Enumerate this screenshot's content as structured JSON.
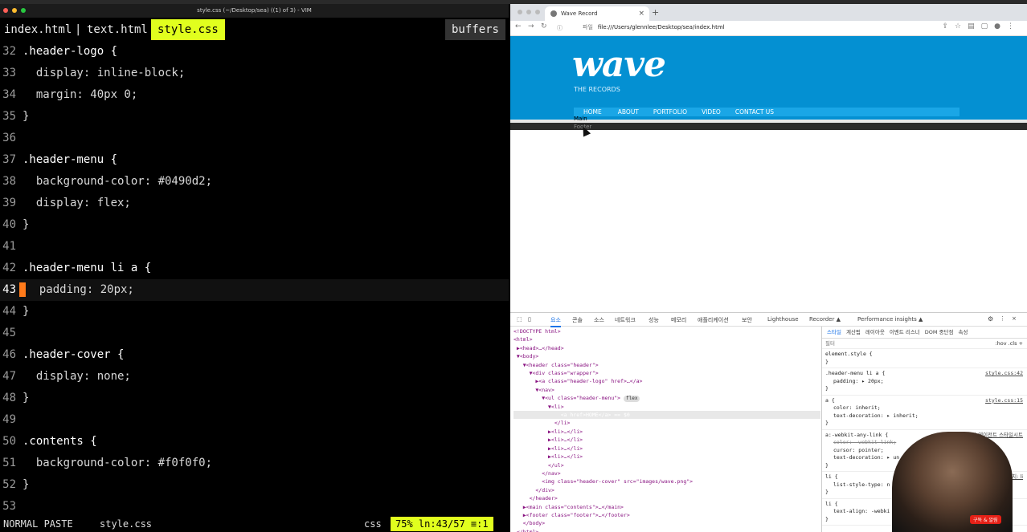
{
  "vim": {
    "title": "style.css (~/Desktop/sea) ((1) of 3) - VIM",
    "tabs": [
      "index.html",
      "text.html",
      "style.css"
    ],
    "tab_sep": "|",
    "buffers_label": "buffers",
    "lines": [
      {
        "n": "32",
        "text": ".header-logo {"
      },
      {
        "n": "33",
        "text": "  display: inline-block;"
      },
      {
        "n": "34",
        "text": "  margin: 40px 0;"
      },
      {
        "n": "35",
        "text": "}"
      },
      {
        "n": "36",
        "text": ""
      },
      {
        "n": "37",
        "text": ".header-menu {"
      },
      {
        "n": "38",
        "text": "  background-color: #0490d2;"
      },
      {
        "n": "39",
        "text": "  display: flex;"
      },
      {
        "n": "40",
        "text": "}"
      },
      {
        "n": "41",
        "text": ""
      },
      {
        "n": "42",
        "text": ".header-menu li a {"
      },
      {
        "n": "43",
        "text": "  padding: 20px;"
      },
      {
        "n": "44",
        "text": "}"
      },
      {
        "n": "45",
        "text": ""
      },
      {
        "n": "46",
        "text": ".header-cover {"
      },
      {
        "n": "47",
        "text": "  display: none;"
      },
      {
        "n": "48",
        "text": "}"
      },
      {
        "n": "49",
        "text": ""
      },
      {
        "n": "50",
        "text": ".contents {"
      },
      {
        "n": "51",
        "text": "  background-color: #f0f0f0;"
      },
      {
        "n": "52",
        "text": "}"
      },
      {
        "n": "53",
        "text": ""
      }
    ],
    "current_line": "43",
    "status": {
      "mode": "NORMAL  PASTE",
      "file": "style.css",
      "filetype": "css",
      "position": "75% ln:43/57 ≡:1"
    }
  },
  "browser": {
    "tab_title": "Wave Record",
    "url_scheme": "파일",
    "url": "file:///Users/glennlee/Desktop/sea/index.html",
    "site": {
      "logo": "wave",
      "logo_sub": "THE RECORDS",
      "menu": [
        "HOME",
        "ABOUT",
        "PORTFOLIO",
        "VIDEO",
        "CONTACT US"
      ],
      "main_label": "Main",
      "footer_label": "Footer"
    },
    "colors": {
      "header": "#0490d2",
      "menu": "#1aa6e6"
    }
  },
  "devtools": {
    "tabs": [
      "요소",
      "콘솔",
      "소스",
      "네트워크",
      "성능",
      "메모리",
      "애플리케이션",
      "보안",
      "Lighthouse",
      "Recorder ▲",
      "Performance insights ▲"
    ],
    "dom_rows": [
      "<!DOCTYPE html>",
      "<html>",
      " ▶<head>…</head>",
      " ▼<body>",
      "   ▼<header class=\"header\">",
      "     ▼<div class=\"wrapper\">",
      "       ▶<a class=\"header-logo\" href>…</a>",
      "       ▼<nav>",
      "         ▼<ul class=\"header-menu\">",
      "           ▼<li>",
      "               <a href>HOME</a> == $0",
      "             </li>",
      "           ▶<li>…</li>",
      "           ▶<li>…</li>",
      "           ▶<li>…</li>",
      "           ▶<li>…</li>",
      "           </ul>",
      "         </nav>",
      "         <img class=\"header-cover\" src=\"images/wave.png\">",
      "       </div>",
      "     </header>",
      "   ▶<main class=\"contents\">…</main>",
      "   ▶<footer class=\"footer\">…</footer>",
      "   </body>",
      " </html>"
    ],
    "flex_badge": "flex",
    "styles_tabs": [
      "스타일",
      "계산됨",
      "레이아웃",
      "이벤트 리스너",
      "DOM 중단점",
      "속성"
    ],
    "filter_placeholder": "필터",
    "filter_right": ":hov .cls +",
    "rules": [
      {
        "selector": "element.style {",
        "decls": [],
        "src": ""
      },
      {
        "selector": ".header-menu li a {",
        "decls": [
          "padding: ▸ 20px;"
        ],
        "src": "style.css:42"
      },
      {
        "selector": "a {",
        "decls": [
          "color: inherit;",
          "text-decoration: ▸ inherit;"
        ],
        "src": "style.css:15"
      },
      {
        "selector": "a:-webkit-any-link {",
        "decls": [
          "color: -webkit-link;",
          "cursor: pointer;",
          "text-decoration: ▸ un"
        ],
        "src": "사용자 에이전트 스타일시트"
      },
      {
        "selector": "li {",
        "decls": [
          "list-style-type: n"
        ],
        "src": "상속 위치: li"
      },
      {
        "selector": "li {",
        "decls": [
          "text-align: -webki"
        ],
        "src": ""
      }
    ],
    "subscribe_label": "구독 & 알림"
  }
}
